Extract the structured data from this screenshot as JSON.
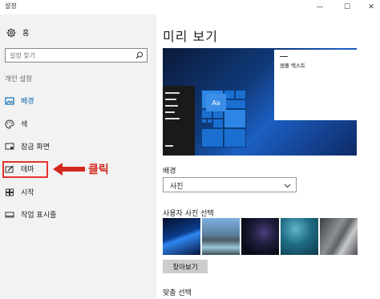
{
  "window": {
    "title": "설정",
    "controls": {
      "minimize": "—",
      "maximize": "☐",
      "close": "✕"
    }
  },
  "sidebar": {
    "home_label": "홈",
    "search_placeholder": "설정 찾기",
    "section_label": "개인 설정",
    "items": [
      {
        "label": "배경",
        "icon": "image-icon",
        "selected": true
      },
      {
        "label": "색",
        "icon": "palette-icon",
        "selected": false
      },
      {
        "label": "잠금 화면",
        "icon": "lock-screen-icon",
        "selected": false
      },
      {
        "label": "테마",
        "icon": "theme-icon",
        "selected": false
      },
      {
        "label": "시작",
        "icon": "start-grid-icon",
        "selected": false
      },
      {
        "label": "작업 표시줄",
        "icon": "taskbar-icon",
        "selected": false
      }
    ]
  },
  "annotation": {
    "label": "클릭",
    "color": "#d4281f"
  },
  "main": {
    "title": "미리 보기",
    "preview_sample_text": "샘플 텍스트",
    "preview_tile_label": "Aa",
    "background_label": "배경",
    "background_value": "사진",
    "photo_select_label": "사용자 사진 선택",
    "browse_button": "찾아보기",
    "fit_label": "맞춤 선택"
  },
  "colors": {
    "accent": "#0063b1",
    "sidebar_bg": "#f2f2f2",
    "annotation_red": "#e3342f"
  }
}
